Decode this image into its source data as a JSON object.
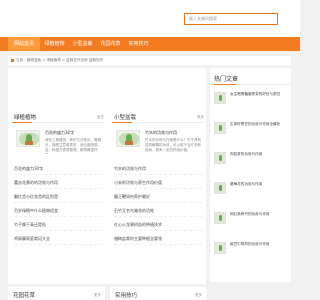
{
  "search": {
    "placeholder": "输入关键词搜索"
  },
  "nav": {
    "items": [
      {
        "label": "网站首页"
      },
      {
        "label": "绿植植物"
      },
      {
        "label": "小型盆栽"
      },
      {
        "label": "花园花草"
      },
      {
        "label": "实用技巧"
      }
    ]
  },
  "breadcrumb": {
    "text": "当前：植物盆栽 > 绿植植物 > 盆栽花卉品种 盆栽知识"
  },
  "columns": [
    {
      "title": "绿植植物",
      "more": "更多",
      "featured_title": "百花的盛力30字",
      "featured_desc": "绿化工程植物，养护方法常见，周期长，施肥注意事项多，适合庭院观赏，种植方便易管理，耐阴喜湿环境。",
      "links": [
        "百花的盛力30字",
        "蕾丝花黄的的功效与作用",
        "翻红苋与红花苋的区别是",
        "百岁绿植中什么植物适宜",
        "竹子属于高还是低",
        "鸡屎藤家庭栽培大全"
      ]
    },
    {
      "title": "小型盆栽",
      "more": "更多",
      "featured_title": "竹木的功效与作用",
      "featured_desc": "竹木的功效与作用是什么？竹子具有祛风解毒的功效，可以用于治疗多种疾病，具有一定的药用价值。",
      "links": [
        "竹木的功效与作用",
        "小米的功效与养生作用价值",
        "霸王鞭如何养护最好",
        "石竹又名鸟巢花的功效",
        "红心火龙果树苗的种植技术",
        "腊梅盆栽的主要种植全要领"
      ]
    }
  ],
  "sidebar": {
    "title": "热门文章",
    "items": [
      "女生喝黑糖姜枣茶的好处与禁忌",
      "生菜籽黑豆的功效与作用全解析",
      "肉桂茶的功效与作用",
      "腊梅花的功效与作用",
      "网红新奇丹的功效与作用",
      "扁豆中草药的功效与作用"
    ]
  },
  "bottom": [
    {
      "title": "花园花草",
      "more": "更多"
    },
    {
      "title": "实用技巧",
      "more": "更多"
    }
  ]
}
